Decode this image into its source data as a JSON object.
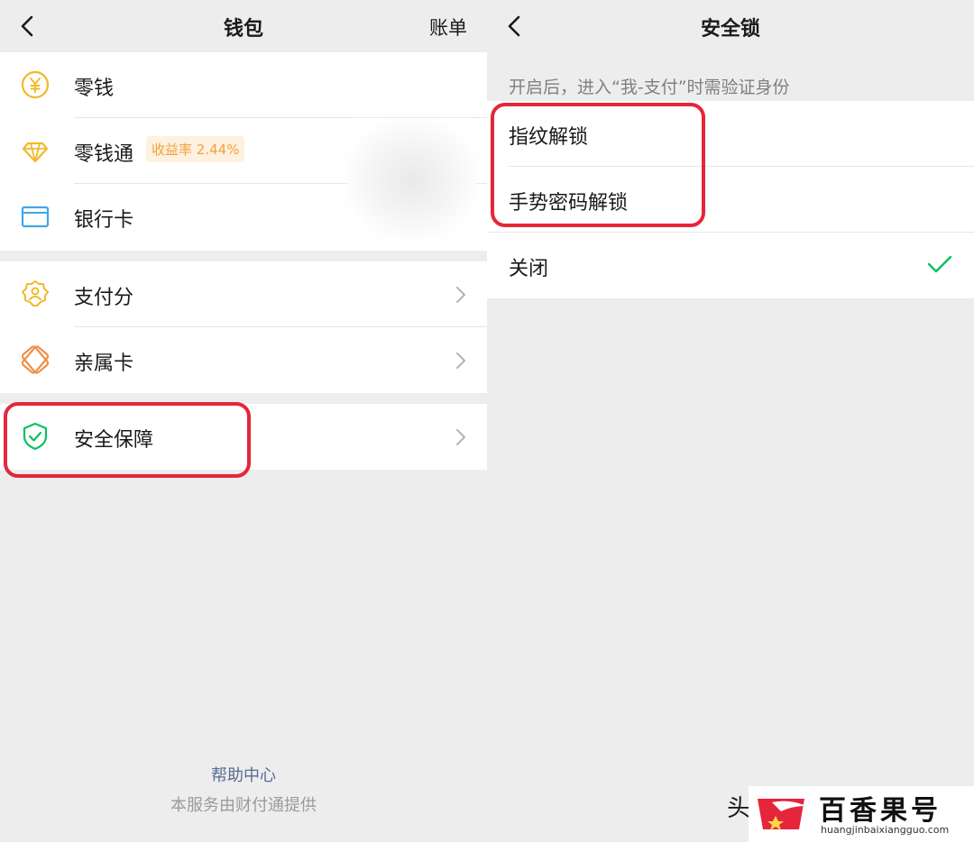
{
  "left": {
    "title": "钱包",
    "right_action": "账单",
    "group1": [
      {
        "label": "零钱",
        "icon": "yuan-coin-icon"
      },
      {
        "label": "零钱通",
        "icon": "diamond-icon",
        "badge": "收益率 2.44%"
      },
      {
        "label": "银行卡",
        "icon": "bank-card-icon"
      }
    ],
    "group2": [
      {
        "label": "支付分",
        "icon": "pay-score-icon"
      },
      {
        "label": "亲属卡",
        "icon": "family-card-icon"
      }
    ],
    "group3": [
      {
        "label": "安全保障",
        "icon": "shield-check-icon"
      }
    ],
    "footer_link": "帮助中心",
    "footer_note": "本服务由财付通提供"
  },
  "right": {
    "title": "安全锁",
    "hint": "开启后，进入“我-支付”时需验证身份",
    "options": [
      {
        "label": "指纹解锁"
      },
      {
        "label": "手势密码解锁"
      },
      {
        "label": "关闭",
        "selected": true
      }
    ]
  },
  "watermark": {
    "prefix": "头",
    "brand": "百香果号",
    "domain": "huangjinbaixiangguo.com"
  },
  "colors": {
    "highlight": "#e5263a",
    "check": "#07c160",
    "link": "#576b95"
  }
}
